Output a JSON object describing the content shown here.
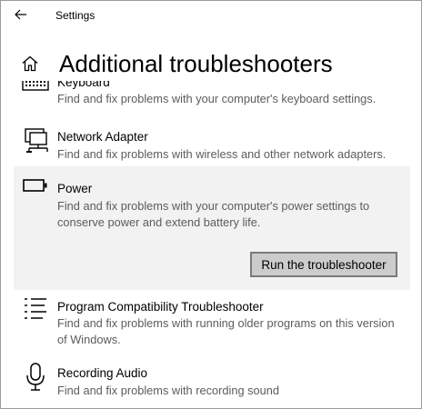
{
  "window": {
    "app_title": "Settings"
  },
  "header": {
    "title": "Additional troubleshooters"
  },
  "troubleshooters": [
    {
      "icon": "keyboard-icon",
      "name": "Keyboard",
      "description": "Find and fix problems with your computer's keyboard settings."
    },
    {
      "icon": "network-adapter-icon",
      "name": "Network Adapter",
      "description": "Find and fix problems with wireless and other network adapters."
    },
    {
      "icon": "battery-icon",
      "name": "Power",
      "description": "Find and fix problems with your computer's power settings to conserve power and extend battery life.",
      "selected": true,
      "action_label": "Run the troubleshooter"
    },
    {
      "icon": "program-list-icon",
      "name": "Program Compatibility Troubleshooter",
      "description": "Find and fix problems with running older programs on this version of Windows."
    },
    {
      "icon": "microphone-icon",
      "name": "Recording Audio",
      "description": "Find and fix problems with recording sound"
    }
  ],
  "colors": {
    "selected_background": "#f2f2f2",
    "button_background": "#cccccc",
    "button_border": "#7a7a7a",
    "description_text": "#5c5c5c"
  }
}
